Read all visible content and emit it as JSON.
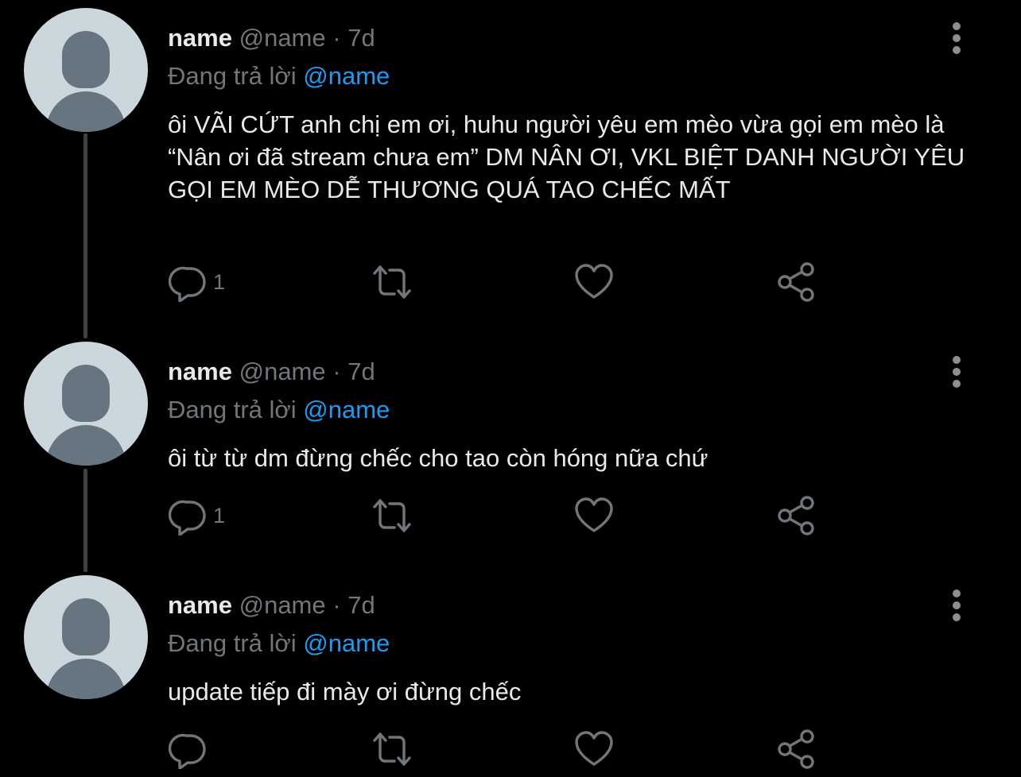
{
  "tweets": [
    {
      "display_name": "name",
      "handle": "@name",
      "separator": "·",
      "time": "7d",
      "replying_label": "Đang trả lời",
      "replying_to": "@name",
      "text": "ôi VÃI CỨT anh chị em ơi, huhu người yêu em mèo vừa gọi em mèo là “Nân ơi đã stream chưa em” DM NÂN ƠI, VKL BIỆT DANH NGƯỜI YÊU GỌI EM MÈO DỄ THƯƠNG QUÁ TAO CHẾC MẤT",
      "reply_count": "1"
    },
    {
      "display_name": "name",
      "handle": "@name",
      "separator": "·",
      "time": "7d",
      "replying_label": "Đang trả lời",
      "replying_to": "@name",
      "text": "ôi từ từ dm đừng chếc cho tao còn hóng nữa chứ",
      "reply_count": "1"
    },
    {
      "display_name": "name",
      "handle": "@name",
      "separator": "·",
      "time": "7d",
      "replying_label": "Đang trả lời",
      "replying_to": "@name",
      "text": "update tiếp đi mày ơi đừng chếc",
      "reply_count": ""
    }
  ],
  "icons": {
    "reply": "reply-icon",
    "retweet": "retweet-icon",
    "like": "heart-icon",
    "share": "share-icon",
    "more": "more-vertical-icon",
    "avatar": "default-avatar-icon"
  },
  "colors": {
    "background": "#000000",
    "text": "#e7e9ea",
    "muted": "#71767b",
    "mention": "#1d9bf0",
    "thread_line": "#3e4144",
    "avatar_bg": "#ccd6dd",
    "avatar_fg": "#66757f"
  }
}
